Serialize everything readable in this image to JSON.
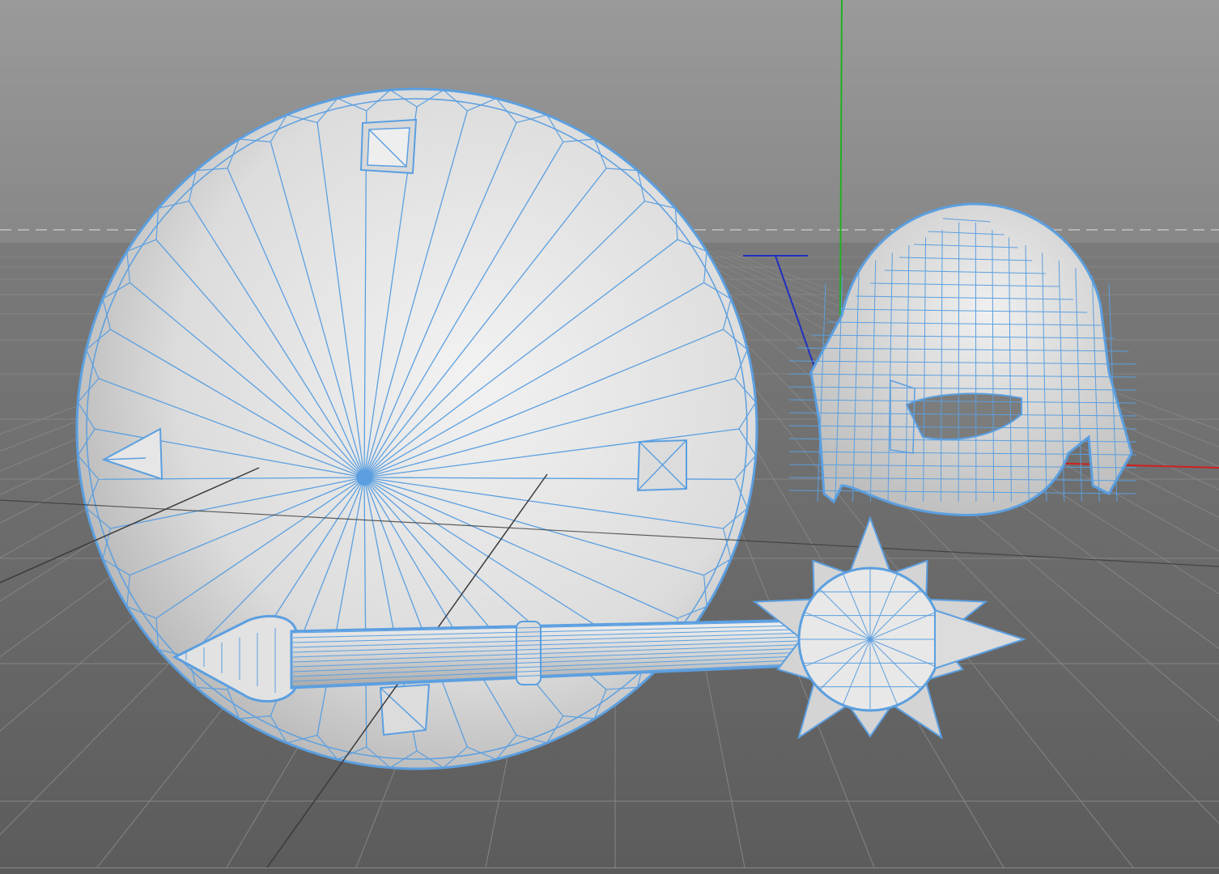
{
  "viewport": {
    "view": "perspective",
    "display_mode": "gouraud-shading-with-wireframe"
  },
  "colors": {
    "sky_top": "#939393",
    "sky_bottom": "#868686",
    "floor_near": "#5f5f5f",
    "floor_far": "#7a7a7a",
    "grid_line": "#858585",
    "horizon_dash": "#b0b0b0",
    "mesh_fill": "#e4e4e4",
    "mesh_shade": "#bdbdbd",
    "wireframe": "#5b9fe0",
    "axis_x": "#d02020",
    "axis_y": "#20b020",
    "axis_z": "#2030c0"
  },
  "scene": {
    "objects": [
      {
        "name": "shield",
        "type": "polygon-object",
        "selected": true
      },
      {
        "name": "helmet",
        "type": "polygon-object",
        "selected": true
      },
      {
        "name": "mace",
        "type": "polygon-object",
        "selected": true
      }
    ],
    "world_axes": [
      "x",
      "y",
      "z"
    ]
  }
}
